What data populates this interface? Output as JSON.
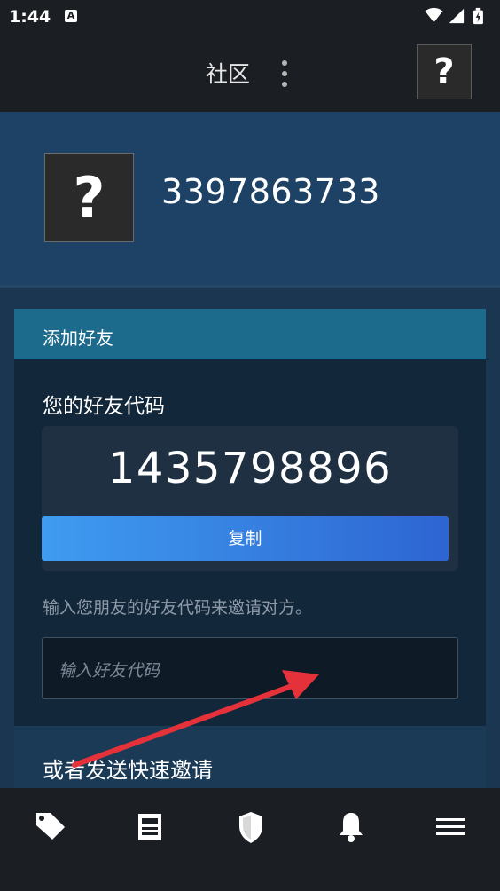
{
  "status_bar": {
    "time": "1:44",
    "notification_icon": "A"
  },
  "app_bar": {
    "title": "社区",
    "menu_icon": "more-vert-icon",
    "avatar_placeholder": "?"
  },
  "profile": {
    "avatar_placeholder": "?",
    "name": "3397863733"
  },
  "add_friend": {
    "header": "添加好友",
    "code_label": "您的好友代码",
    "friend_code": "1435798896",
    "copy_label": "复制",
    "hint": "输入您朋友的好友代码来邀请对方。",
    "input_placeholder": "输入好友代码",
    "quick_invite_label": "或者发送快速邀请"
  },
  "bottom_nav": [
    {
      "icon": "tag-icon",
      "name": "nav-store"
    },
    {
      "icon": "news-icon",
      "name": "nav-news"
    },
    {
      "icon": "shield-icon",
      "name": "nav-guard"
    },
    {
      "icon": "bell-icon",
      "name": "nav-notifications"
    },
    {
      "icon": "hamburger-icon",
      "name": "nav-menu"
    }
  ],
  "colors": {
    "accent_button_start": "#3f9cf0",
    "accent_button_end": "#2d65d2",
    "header_teal": "#1c6b8c",
    "annotation_arrow": "#e5323a"
  }
}
